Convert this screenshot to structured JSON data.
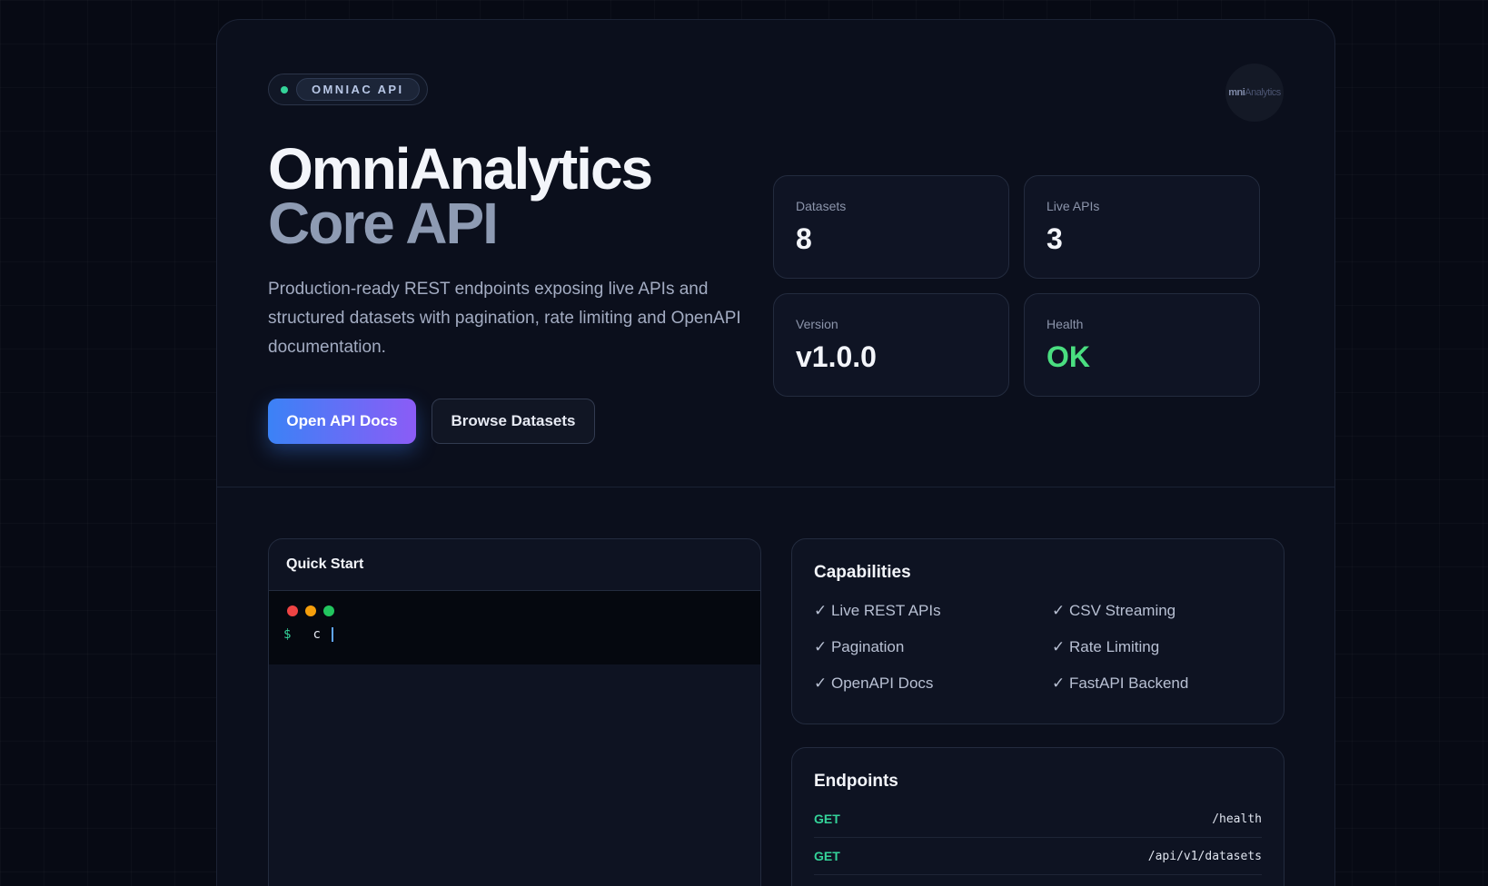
{
  "badge": {
    "label": "OMNIAC API"
  },
  "logo": {
    "text_a": "mni",
    "text_b": "Analytics"
  },
  "hero": {
    "title_line1": "OmniAnalytics",
    "title_line2": "Core API",
    "description": "Production-ready REST endpoints exposing live APIs and structured datasets with pagination, rate limiting and OpenAPI documentation."
  },
  "buttons": {
    "primary": "Open API Docs",
    "secondary": "Browse Datasets"
  },
  "stats": [
    {
      "label": "Datasets",
      "value": "8"
    },
    {
      "label": "Live APIs",
      "value": "3"
    },
    {
      "label": "Version",
      "value": "v1.0.0"
    },
    {
      "label": "Health",
      "value": "OK"
    }
  ],
  "quick_start": {
    "title": "Quick Start",
    "prompt": "$",
    "command": "c"
  },
  "capabilities": {
    "title": "Capabilities",
    "items": [
      "✓ Live REST APIs",
      "✓ CSV Streaming",
      "✓ Pagination",
      "✓ Rate Limiting",
      "✓ OpenAPI Docs",
      "✓ FastAPI Backend"
    ]
  },
  "endpoints": {
    "title": "Endpoints",
    "rows": [
      {
        "method": "GET",
        "path": "/health"
      },
      {
        "method": "GET",
        "path": "/api/v1/datasets"
      }
    ]
  },
  "colors": {
    "accent_green": "#34d399",
    "health_ok": "#4ade80",
    "gradient_start": "#3b82f6",
    "gradient_end": "#8b5cf6",
    "traffic_red": "#ef4444",
    "traffic_yellow": "#f59e0b",
    "traffic_green": "#22c55e"
  }
}
